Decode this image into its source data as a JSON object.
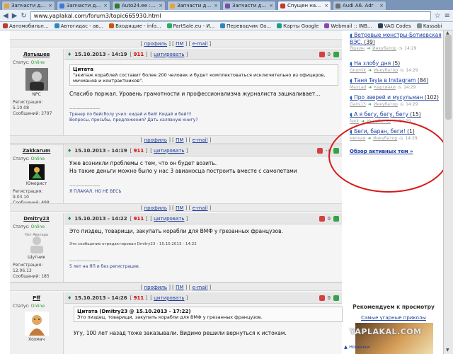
{
  "browser": {
    "tabs": [
      {
        "title": "Запчасти для а",
        "color": "#e6a23c",
        "active": false
      },
      {
        "title": "Запчасти для а",
        "color": "#3a7bd5",
        "active": false
      },
      {
        "title": "Auto24.ee : за",
        "color": "#2f7a2f",
        "active": false
      },
      {
        "title": "Запчасти для а",
        "color": "#e6a23c",
        "active": false
      },
      {
        "title": "Запчасти для а",
        "color": "#7b4ea3",
        "active": false
      },
      {
        "title": "Спущен на вод",
        "color": "#c0392b",
        "active": true
      },
      {
        "title": "Audi A6. Adr",
        "color": "#6d6d6d",
        "active": false
      }
    ],
    "url": "www.yaplakal.com/forum3/topic665930.html",
    "bookmarks": [
      {
        "label": "Автомобильн...",
        "color": "#c0392b"
      },
      {
        "label": "Автогидас - ав...",
        "color": "#2e86c1"
      },
      {
        "label": "Входящие - info...",
        "color": "#d35400"
      },
      {
        "label": "PartSale.eu - И...",
        "color": "#27ae60"
      },
      {
        "label": "Переводчик Go...",
        "color": "#2e86c1"
      },
      {
        "label": "Карты Google",
        "color": "#16a085"
      },
      {
        "label": "Webmail :: INB...",
        "color": "#8e44ad"
      },
      {
        "label": "VAG Codes",
        "color": "#2c3e50"
      },
      {
        "label": "Kassabi",
        "color": "#7f8c8d"
      }
    ]
  },
  "profile_bar": {
    "profile": "профиль",
    "pm": "ПМ",
    "email": "e-mail"
  },
  "posts": [
    {
      "author": "Латышев",
      "status_label": "Статус:",
      "status_value": "Online",
      "rank": "NPC",
      "registered": "Регистрация: 5.10.08",
      "messages": "Сообщений: 2797",
      "date": "15.10.2013 - 14:19",
      "rating": "911",
      "quote_link": "цитировать",
      "score": "0",
      "quote_title": "Цитата",
      "quote_text": "\"экипаж кораблей составит более 200 человек и будет комплектоваться исключительно из офицеров, мичманов и контрактников\".",
      "text": "Спасибо поржал. Уровень грамотности и профессионализма журналиста зашкаливает...",
      "sig_line": "--------------------",
      "sig1": "Тренер по бейсболу учил: кидай и бей! Кидай и бей!!!",
      "sig2": "Вопросы, просьбы, предложения? Дать халявную книгу?"
    },
    {
      "author": "Zakkarum",
      "status_label": "Статус:",
      "status_value": "Online",
      "rank": "Юморист",
      "registered": "Регистрация: 9.03.10",
      "messages": "Сообщений: 498",
      "date": "15.10.2013 - 14:19",
      "rating": "911",
      "quote_link": "цитировать",
      "score": "-3",
      "text1": "Уже возникли проблемы с тем, что он будет возить.",
      "text2": "На такие деньги можно было у нас 3 авианосца построить вместе с самолетами",
      "sig_line": "--------------------",
      "sig1": "Я ПЛАКАЛ. НО НЕ ВЕСЬ"
    },
    {
      "author": "Dmitry23",
      "status_label": "Статус:",
      "status_value": "Online",
      "avatar_text": "Нет Аватара",
      "rank": "Шутник",
      "registered": "Регистрация: 12.06.13",
      "messages": "Сообщений: 185",
      "date": "15.10.2013 - 14:22",
      "rating": "911",
      "quote_link": "цитировать",
      "score": "0",
      "text": "Это пиздец, товарищи, закупать корабли для ВМФ у грезанных французов.",
      "edit": "Это сообщение отредактировал Dmitry23 - 15.10.2013 - 14:22",
      "sig_line": "--------------------",
      "sig1": "5 лет на ЯП и без регистрации."
    },
    {
      "author": "Pff",
      "status_label": "Статус:",
      "status_value": "Online",
      "rank": "Хохмач",
      "date": "15.10.2013 - 14:26",
      "rating": "911",
      "quote_link": "цитировать",
      "score": "0",
      "quote_title": "Цитата (Dmitry23 @ 15.10.2013 - 17:22)",
      "quote_text": "Это пиздец, товарищи, закупать корабли для ВМФ у грезанных французов.",
      "text": "Угу, 100 лет назад тоже заказывали. Видимо решили вернуться к истокам."
    }
  ],
  "sidebar": {
    "topics": [
      {
        "title": "Ветровые монстры-Ботиевская ВЭС.",
        "count": "(39)",
        "user": "Яшкин",
        "dest": "Инкубатор",
        "time": "14:29"
      },
      {
        "title": "На злобу дня",
        "count": "(5)",
        "user": "Gnomik",
        "dest": "Инкубатор",
        "time": "14:29"
      },
      {
        "title": "Таня Tayla в Instagram",
        "count": "(84)",
        "user": "MaxLad",
        "dest": "Картинки",
        "time": "14:29"
      },
      {
        "title": "Про зверей и мусульман",
        "count": "(102)",
        "user": "Gans13",
        "dest": "Инкубатор",
        "time": "14:29"
      },
      {
        "title": "А я бегу, бегу, бегу",
        "count": "(15)",
        "user": "fenk",
        "dest": "Инкубатор",
        "time": "14:29"
      },
      {
        "title": "Беги, баран, беги!",
        "count": "(1)",
        "user": "мягкая",
        "dest": "Инкубатор",
        "time": "14:29"
      }
    ],
    "overview_link": "Обзор активных тем »",
    "recommend_title": "Рекомендуем к просмотру",
    "recommend_link": "Самые угарные приколы",
    "watermark": "YAPLAKAL.COM",
    "more": "▲ Новинки"
  }
}
